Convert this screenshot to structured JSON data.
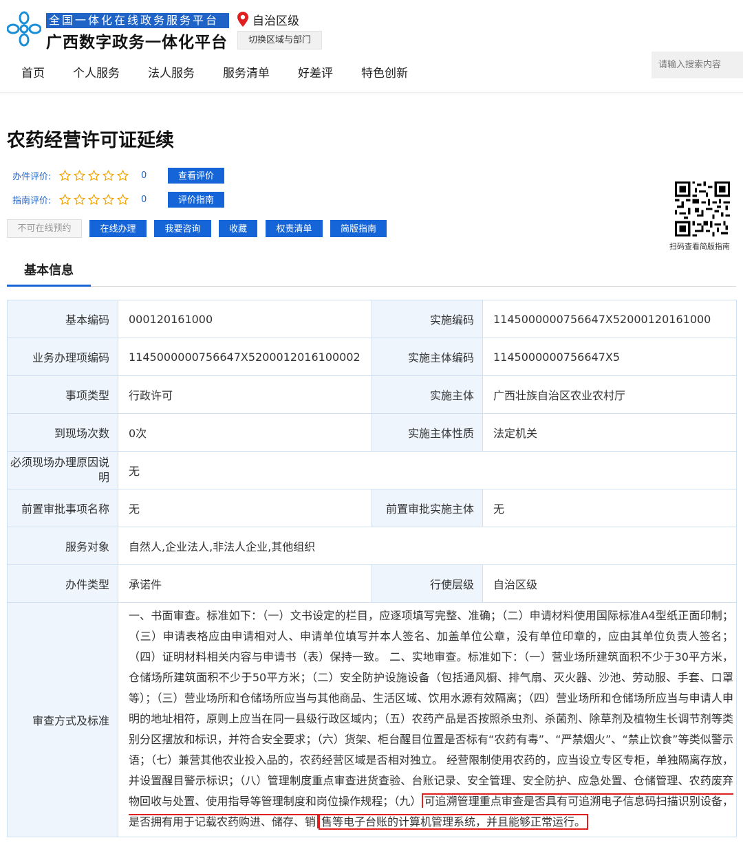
{
  "header": {
    "platform_banner": "全国一体化在线政务服务平台",
    "platform_name": "广西数字政务一体化平台",
    "location": "自治区级",
    "switch_label": "切换区域与部门",
    "search_placeholder": "请输入搜索内容",
    "nav": [
      "首页",
      "个人服务",
      "法人服务",
      "服务清单",
      "好差评",
      "特色创新"
    ]
  },
  "page": {
    "title": "农药经营许可证延续",
    "ratings": [
      {
        "label": "办件评价:",
        "stars": 0,
        "max": 5,
        "count": "0",
        "button": "查看评价"
      },
      {
        "label": "指南评价:",
        "stars": 0,
        "max": 5,
        "count": "0",
        "button": "评价指南"
      }
    ],
    "actions": {
      "disabled": "不可在线预约",
      "online": "在线办理",
      "consult": "我要咨询",
      "favorite": "收藏",
      "rights": "权责清单",
      "simple_guide": "简版指南"
    },
    "qr_caption": "扫码查看简版指南",
    "tab": "基本信息"
  },
  "info": {
    "basic_code_label": "基本编码",
    "basic_code": "000120161000",
    "impl_code_label": "实施编码",
    "impl_code": "1145000000756647X52000120161000",
    "business_code_label": "业务办理项编码",
    "business_code": "1145000000756647X5200012016100002",
    "subject_code_label": "实施主体编码",
    "subject_code": "1145000000756647X5",
    "item_type_label": "事项类型",
    "item_type": "行政许可",
    "subject_label": "实施主体",
    "subject": "广西壮族自治区农业农村厅",
    "visits_label": "到现场次数",
    "visits": "0次",
    "subject_nature_label": "实施主体性质",
    "subject_nature": "法定机关",
    "onsite_reason_label": "必须现场办理原因说明",
    "onsite_reason": "无",
    "pre_item_label": "前置审批事项名称",
    "pre_item": "无",
    "pre_subject_label": "前置审批实施主体",
    "pre_subject": "无",
    "target_label": "服务对象",
    "target": "自然人,企业法人,非法人企业,其他组织",
    "handle_type_label": "办件类型",
    "handle_type": "承诺件",
    "level_label": "行使层级",
    "level": "自治区级",
    "review_label": "审查方式及标准",
    "review_text": "一、书面审查。标准如下：（一）文书设定的栏目，应逐项填写完整、准确；（二）申请材料使用国际标准A4型纸正面印制；（三）申请表格应由申请相对人、申请单位填写并本人签名、加盖单位公章，没有单位印章的，应由其单位负责人签名；（四）证明材料相关内容与申请书（表）保持一致。 二、实地审查。标准如下：（一）营业场所建筑面积不少于30平方米，仓储场所建筑面积不少于50平方米；（二）安全防护设施设备（包括通风橱、排气扇、灭火器、沙池、劳动服、手套、口罩等）；（三）营业场所和仓储场所应当与其他商品、生活区域、饮用水源有效隔离；（四）营业场所和仓储场所应当与申请人申明的地址相符，原则上应当在同一县级行政区域内；（五）农药产品是否按照杀虫剂、杀菌剂、除草剂及植物生长调节剂等类别分区摆放和标识，并符合安全要求；（六）货架、柜台醒目位置是否标有“农药有毒”、“严禁烟火”、“禁止饮食”等类似警示语；（七）兼营其他农业投入品的，农药经营区域是否相对独立。 经营限制使用农药的，应当设立专区专柜，单独隔离存放，并设置醒目警示标识；（八）管理制度重点审查进货查验、台账记录、安全管理、安全防护、应急处置、仓储管理、农药废弃物回收与处置、使用指导等管理制度和岗位操作规程；（九）",
    "review_highlight_1": "可追溯管理重点审查是否具有可追溯电子信息码扫描识别设备，是否拥有用于记载农药购进、储存、销",
    "review_highlight_2": "售等电子台账的计算机管理系统，并且能够正常运行。"
  },
  "colors": {
    "brand_blue": "#1565d8",
    "label_bg": "#eef5fd",
    "highlight_red": "#e02020"
  }
}
